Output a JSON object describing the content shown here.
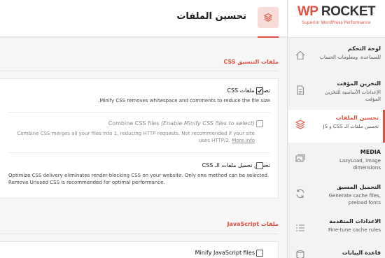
{
  "brand": {
    "name_part1": "WP",
    "name_part2": "ROCKET",
    "tagline": "Superior WordPress Performance"
  },
  "sidebar": {
    "items": [
      {
        "title": "لوحة التحكم",
        "desc": "للمساعدة، ومعلومات الحساب",
        "icon": "home-icon"
      },
      {
        "title": "التخزين المؤقت",
        "desc": "الإعدادات الأساسية للتخزين المؤقت",
        "icon": "document-icon"
      },
      {
        "title": "تحسين الملفات",
        "desc": "تحسين ملفات الـ CSS و JS",
        "icon": "layers-icon"
      },
      {
        "title": "MEDIA",
        "desc": "LazyLoad, image dimensions",
        "icon": "images-icon"
      },
      {
        "title": "التحميل المسبق",
        "desc": "Generate cache files, preload fonts",
        "icon": "refresh-icon"
      },
      {
        "title": "الاعدادات المتقدمة",
        "desc": "Fine-tune cache rules",
        "icon": "list-icon"
      },
      {
        "title": "قاعدة البيانات",
        "desc": "",
        "icon": "database-icon"
      }
    ]
  },
  "header": {
    "title": "تحسين الملفات",
    "icon": "layers-icon"
  },
  "css_section": {
    "title": "ملفات التنسيق CSS",
    "options": [
      {
        "label": "تصغير ملفات CSS",
        "desc": "Minify CSS removes whitespace and comments to reduce the file size.",
        "checked": true,
        "disabled": false
      },
      {
        "label_main": "Combine CSS files",
        "label_note": "(Enable Minify CSS files to select)",
        "desc": "Combine CSS merges all your files into 1, reducing HTTP requests. Not recommended if your site uses HTTP/2.",
        "more": "More info",
        "checked": false,
        "disabled": true
      },
      {
        "label": "تحسين تحميل ملفات الـ CSS",
        "desc": "Optimize CSS delivery eliminates render-blocking CSS on your website. Only one method can be selected. Remove Unused CSS is recommended for optimal performance.",
        "checked": false,
        "disabled": false
      }
    ]
  },
  "js_section": {
    "title": "ملفات JavaScript",
    "options": [
      {
        "label": "Minify JavaScript files",
        "checked": false,
        "disabled": false
      }
    ]
  },
  "colors": {
    "accent": "#e0503f",
    "accent_light": "#f7dcd8",
    "sidebar_bg": "#f3f3f4"
  }
}
